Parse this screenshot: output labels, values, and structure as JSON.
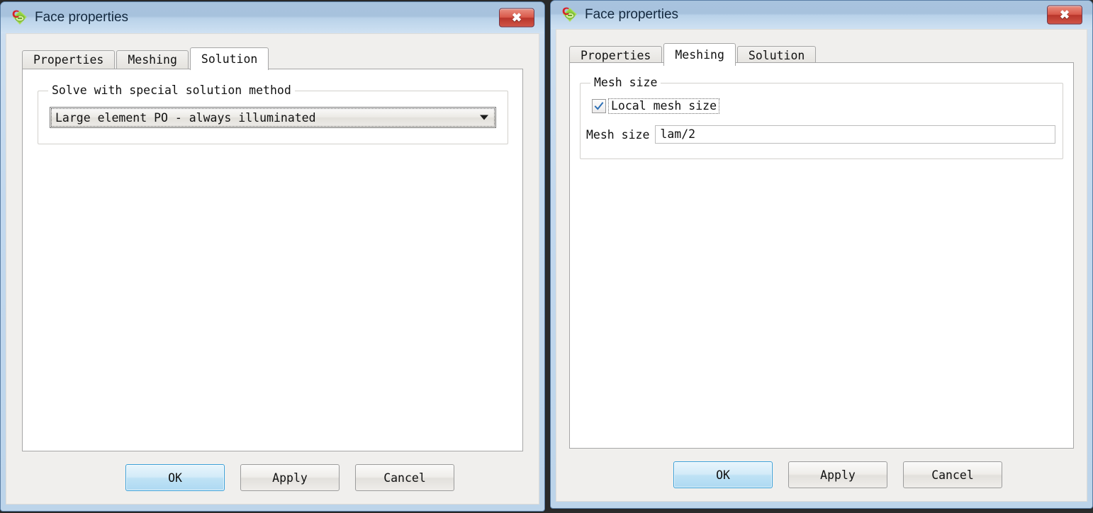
{
  "dialogs": [
    {
      "id": "left",
      "title": "Face properties",
      "icon": "app-logo-icon",
      "close_label": "✖",
      "tabs": [
        {
          "label": "Properties",
          "active": false
        },
        {
          "label": "Meshing",
          "active": false
        },
        {
          "label": "Solution",
          "active": true
        }
      ],
      "solution_page": {
        "group_title": "Solve with special solution method",
        "combo": {
          "value": "Large element PO - always illuminated",
          "options": [
            "Large element PO - always illuminated"
          ]
        }
      },
      "buttons": [
        {
          "label": "OK",
          "default": true
        },
        {
          "label": "Apply",
          "default": false
        },
        {
          "label": "Cancel",
          "default": false
        }
      ]
    },
    {
      "id": "right",
      "title": "Face properties",
      "icon": "app-logo-icon",
      "close_label": "✖",
      "tabs": [
        {
          "label": "Properties",
          "active": false
        },
        {
          "label": "Meshing",
          "active": true
        },
        {
          "label": "Solution",
          "active": false
        }
      ],
      "meshing_page": {
        "group_title": "Mesh size",
        "checkbox": {
          "label": "Local mesh size",
          "checked": true
        },
        "field": {
          "label": "Mesh size",
          "value": "lam/2",
          "placeholder": ""
        }
      },
      "buttons": [
        {
          "label": "OK",
          "default": true
        },
        {
          "label": "Apply",
          "default": false
        },
        {
          "label": "Cancel",
          "default": false
        }
      ]
    }
  ],
  "colors": {
    "titlebar_top": "#a8c3de",
    "titlebar_bottom": "#cfe1f2",
    "window_frame": "#bcd4ea",
    "close_button": "#c9433a",
    "default_button_border": "#3aa0d8",
    "checkbox_check": "#2b6fb5",
    "client_bg": "#f0efed",
    "page_bg": "#ffffff",
    "desktop_bg": "#2b2b2b"
  }
}
